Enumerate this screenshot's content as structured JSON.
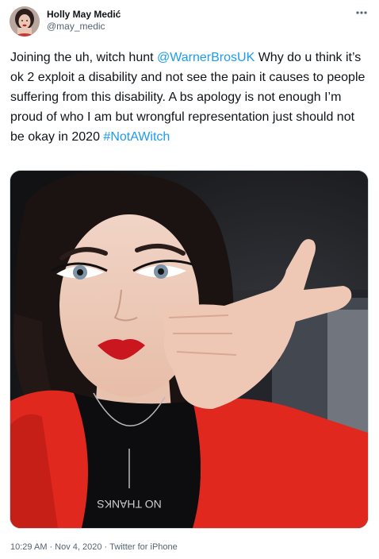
{
  "author": {
    "display_name": "Holly May Medić",
    "handle": "@may_medic"
  },
  "tweet": {
    "segments": [
      {
        "text": "Joining the uh, witch hunt ",
        "type": "text"
      },
      {
        "text": "@WarnerBrosUK",
        "type": "mention"
      },
      {
        "text": " Why do u think it’s ok 2 exploit a disability and not see the pain it causes to people suffering from this disability. A bs apology is not enough I’m proud of who I am but wrongful representation just should not be okay in 2020 ",
        "type": "text"
      },
      {
        "text": "#NotAWitch",
        "type": "hashtag"
      }
    ]
  },
  "meta": {
    "time": "10:29 AM",
    "separator_1": "·",
    "date": "Nov 4, 2020",
    "separator_2": "·",
    "source": "Twitter for iPhone"
  },
  "shirt_text": "NO THANKS",
  "colors": {
    "link": "#1d9bf0",
    "text": "#0f1419",
    "muted": "#536471",
    "jacket": "#e0281e"
  },
  "icons": {
    "more": "more-options-icon"
  }
}
